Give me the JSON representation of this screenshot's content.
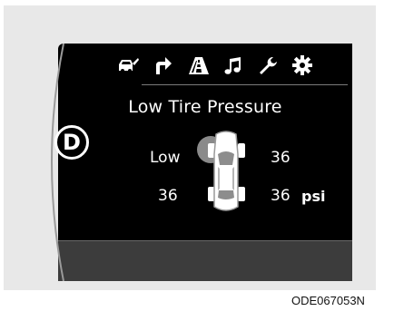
{
  "display": {
    "title": "Low Tire Pressure",
    "gear": "D",
    "tires": {
      "front_left": "Low",
      "front_right": "36",
      "rear_left": "36",
      "rear_right": "36",
      "unit": "psi"
    },
    "low_tire": "front-left",
    "menu_icons": [
      "car-door-icon",
      "turn-arrow-icon",
      "lane-road-icon",
      "music-note-icon",
      "wrench-icon",
      "gear-icon"
    ]
  },
  "caption": "ODE067053N"
}
